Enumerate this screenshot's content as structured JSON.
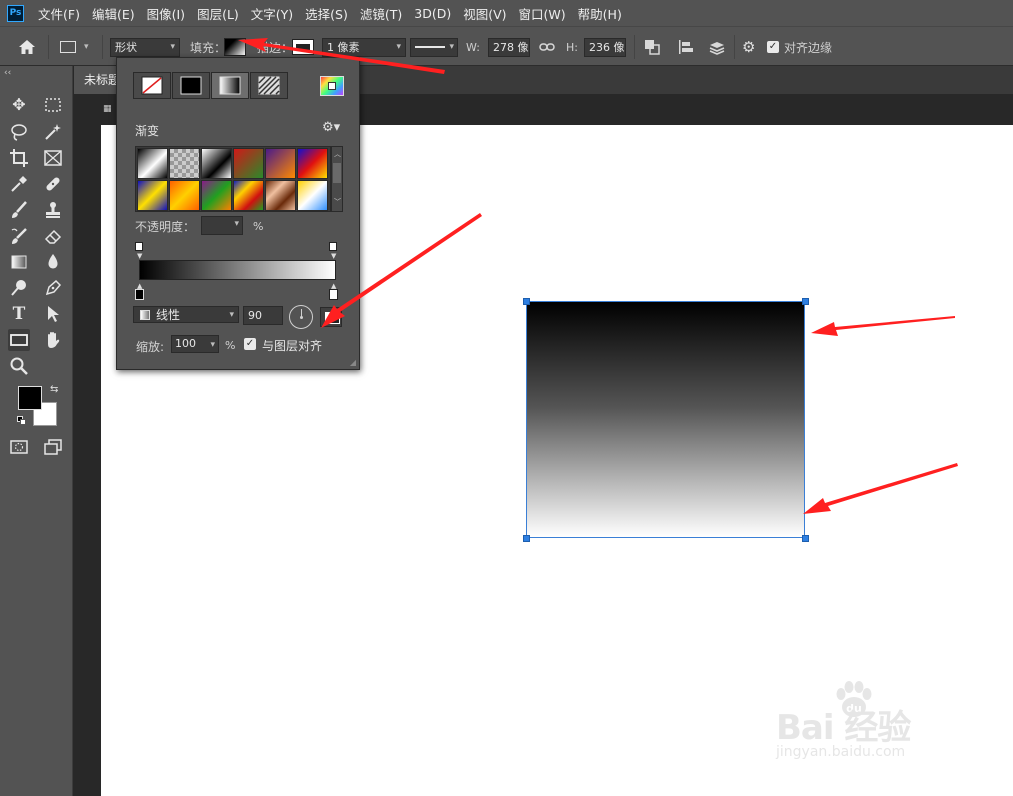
{
  "app": {
    "logo_text": "Ps"
  },
  "menubar": {
    "items": [
      "文件(F)",
      "编辑(E)",
      "图像(I)",
      "图层(L)",
      "文字(Y)",
      "选择(S)",
      "滤镜(T)",
      "3D(D)",
      "视图(V)",
      "窗口(W)",
      "帮助(H)"
    ]
  },
  "optionsbar": {
    "mode": "形状",
    "fill_label": "填充：",
    "stroke_label": "描边：",
    "stroke_width": "1 像素",
    "w_label": "W:",
    "w_value": "278 像",
    "h_label": "H:",
    "h_value": "236 像",
    "align_edges_label": "对齐边缘",
    "align_edges_checked": true
  },
  "document": {
    "tab_title": "未标题"
  },
  "fill_popup": {
    "heading": "渐变",
    "opacity_label": "不透明度：",
    "opacity_unit": "%",
    "style": "线性",
    "angle": "90",
    "scale_label": "缩放:",
    "scale_value": "100",
    "scale_unit": "%",
    "align_layer_label": "与图层对齐",
    "align_layer_checked": true
  },
  "watermark": {
    "main": "Bai 经验",
    "sub": "jingyan.baidu.com"
  },
  "colors": {
    "accent_blue": "#2d7fe2",
    "arrow_red": "#ff2020",
    "panel_gray": "#535353"
  }
}
